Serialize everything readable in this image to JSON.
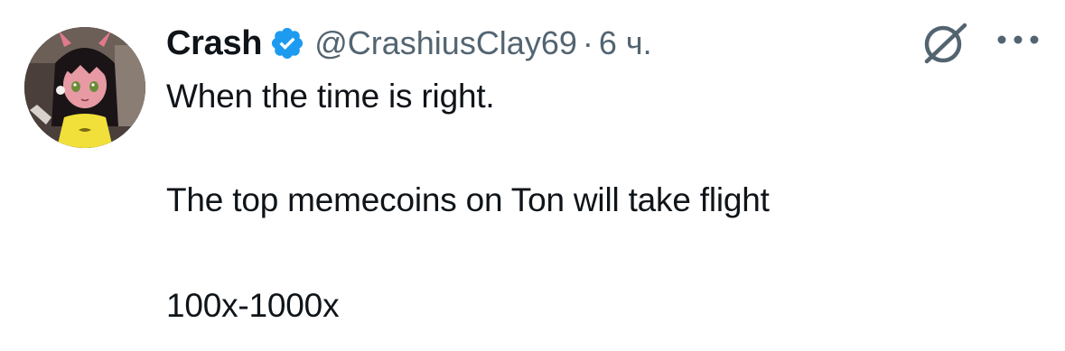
{
  "tweet": {
    "author": {
      "name": "Crash",
      "handle": "@CrashiusClay69",
      "verified": true,
      "avatar_icon": "anime-girl-avatar"
    },
    "separator": "·",
    "time": "6 ч.",
    "lines": [
      "When the time is right.",
      "The top memecoins on Ton will take flight",
      "100x-1000x"
    ]
  },
  "icons": {
    "verified": "verified-badge-icon",
    "grok": "grok-icon",
    "more": "more-options-icon"
  },
  "colors": {
    "text_primary": "#0f1419",
    "text_secondary": "#536471",
    "verified_blue": "#1d9bf0",
    "background": "#ffffff"
  }
}
